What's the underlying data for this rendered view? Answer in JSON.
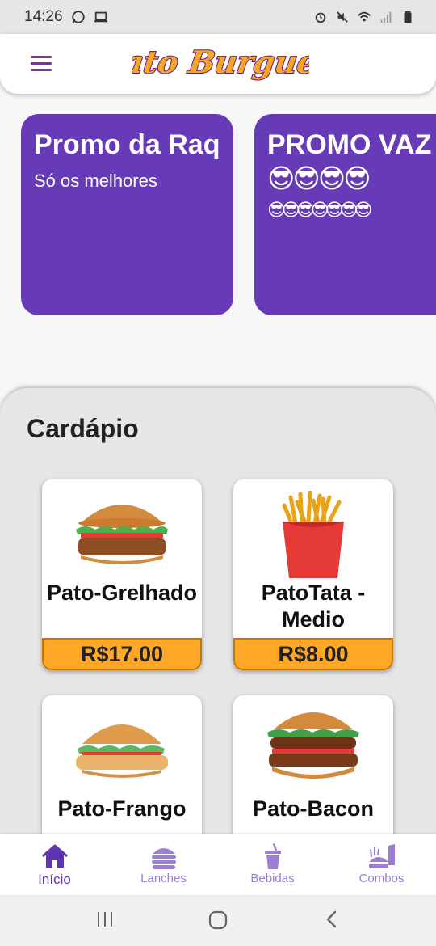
{
  "status_bar": {
    "time": "14:26"
  },
  "header": {
    "logo_text": "Pato Burguer"
  },
  "promos": [
    {
      "title": "Promo da Raq",
      "subtitle": "Só os melhores"
    },
    {
      "title": "PROMO VAZ",
      "subtitle": "😎😎😎😎",
      "subtitle2": "😎😎😎😎😎😎😎"
    }
  ],
  "menu": {
    "title": "Cardápio",
    "products": [
      {
        "name": "Pato-Grelhado",
        "price": "R$17.00"
      },
      {
        "name": "PatoTata - Medio",
        "price": "R$8.00"
      },
      {
        "name": "Pato-Frango",
        "price": ""
      },
      {
        "name": "Pato-Bacon",
        "price": ""
      }
    ]
  },
  "bottom_nav": {
    "items": [
      {
        "label": "Início",
        "icon": "home-icon"
      },
      {
        "label": "Lanches",
        "icon": "burger-icon"
      },
      {
        "label": "Bebidas",
        "icon": "drink-icon"
      },
      {
        "label": "Combos",
        "icon": "combo-icon"
      }
    ]
  },
  "colors": {
    "primary": "#673ab7",
    "accent": "#ffa726",
    "menu_icon": "#7b2fa8",
    "nav_active": "#5e35b1",
    "nav_inactive": "#9c7fd0"
  }
}
